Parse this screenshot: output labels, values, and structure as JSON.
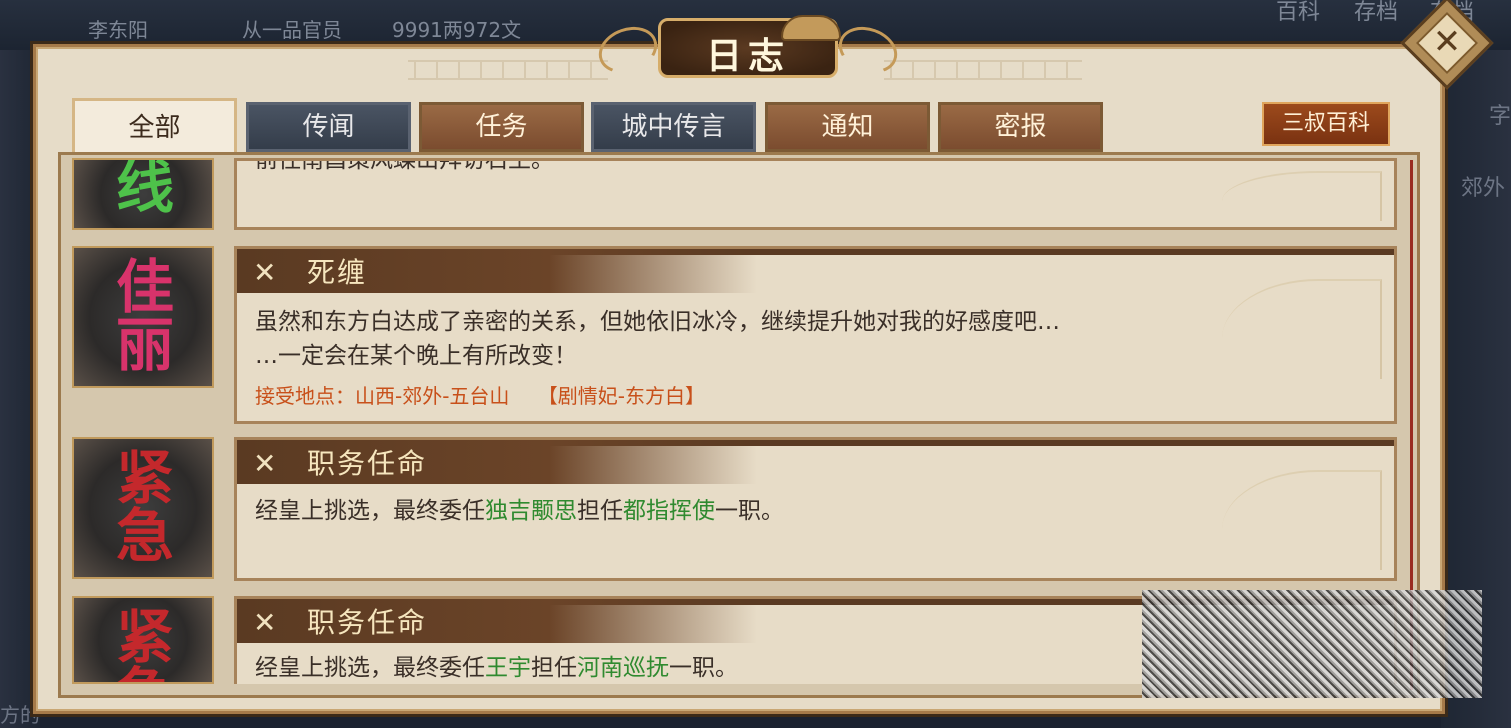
{
  "background": {
    "top_row": [
      "李东阳",
      "从一品官员",
      "9991两972文"
    ],
    "top_right": [
      "百科",
      "存档",
      "存档"
    ],
    "right_labels": [
      "字",
      "郊外"
    ],
    "bottom_left": "方的"
  },
  "dialog": {
    "title": "日志",
    "close_glyph": "✕"
  },
  "tabs": [
    {
      "label": "全部"
    },
    {
      "label": "传闻"
    },
    {
      "label": "任务"
    },
    {
      "label": "城中传言"
    },
    {
      "label": "通知"
    },
    {
      "label": "密报"
    }
  ],
  "encyclopedia_button": "三叔百科",
  "entries": [
    {
      "badge": [
        "线"
      ],
      "body_line": "前往南昌策风蝶山拜访石王。"
    },
    {
      "badge": [
        "佳",
        "丽"
      ],
      "title": "死缠",
      "body_line1": "虽然和东方白达成了亲密的关系，但她依旧冰冷，继续提升她对我的好感度吧…",
      "body_line2": "…一定会在某个晚上有所改变！",
      "meta_location": "接受地点：山西-郊外-五台山",
      "meta_tag": "【剧情妃-东方白】"
    },
    {
      "badge": [
        "紧",
        "急"
      ],
      "title": "职务任命",
      "body_pre": "经皇上挑选，最终委任",
      "person": "独吉颙思",
      "body_mid": "担任",
      "post": "都指挥使",
      "body_post": "一职。"
    },
    {
      "badge": [
        "紧",
        "急"
      ],
      "title": "职务任命",
      "body_pre": "经皇上挑选，最终委任",
      "person": "王宇",
      "body_mid": "担任",
      "post": "河南巡抚",
      "body_post": "一职。"
    }
  ],
  "colors": {
    "accent_gold": "#d6ad6a",
    "highlight_green": "#2f8a2f",
    "meta_orange": "#c8501a",
    "badge_green": "#4ec24a",
    "badge_pink": "#d8336b",
    "badge_red": "#c4282c"
  },
  "icons": {
    "entry_header_icon": "crossed-swords-icon",
    "close": "close-icon"
  }
}
